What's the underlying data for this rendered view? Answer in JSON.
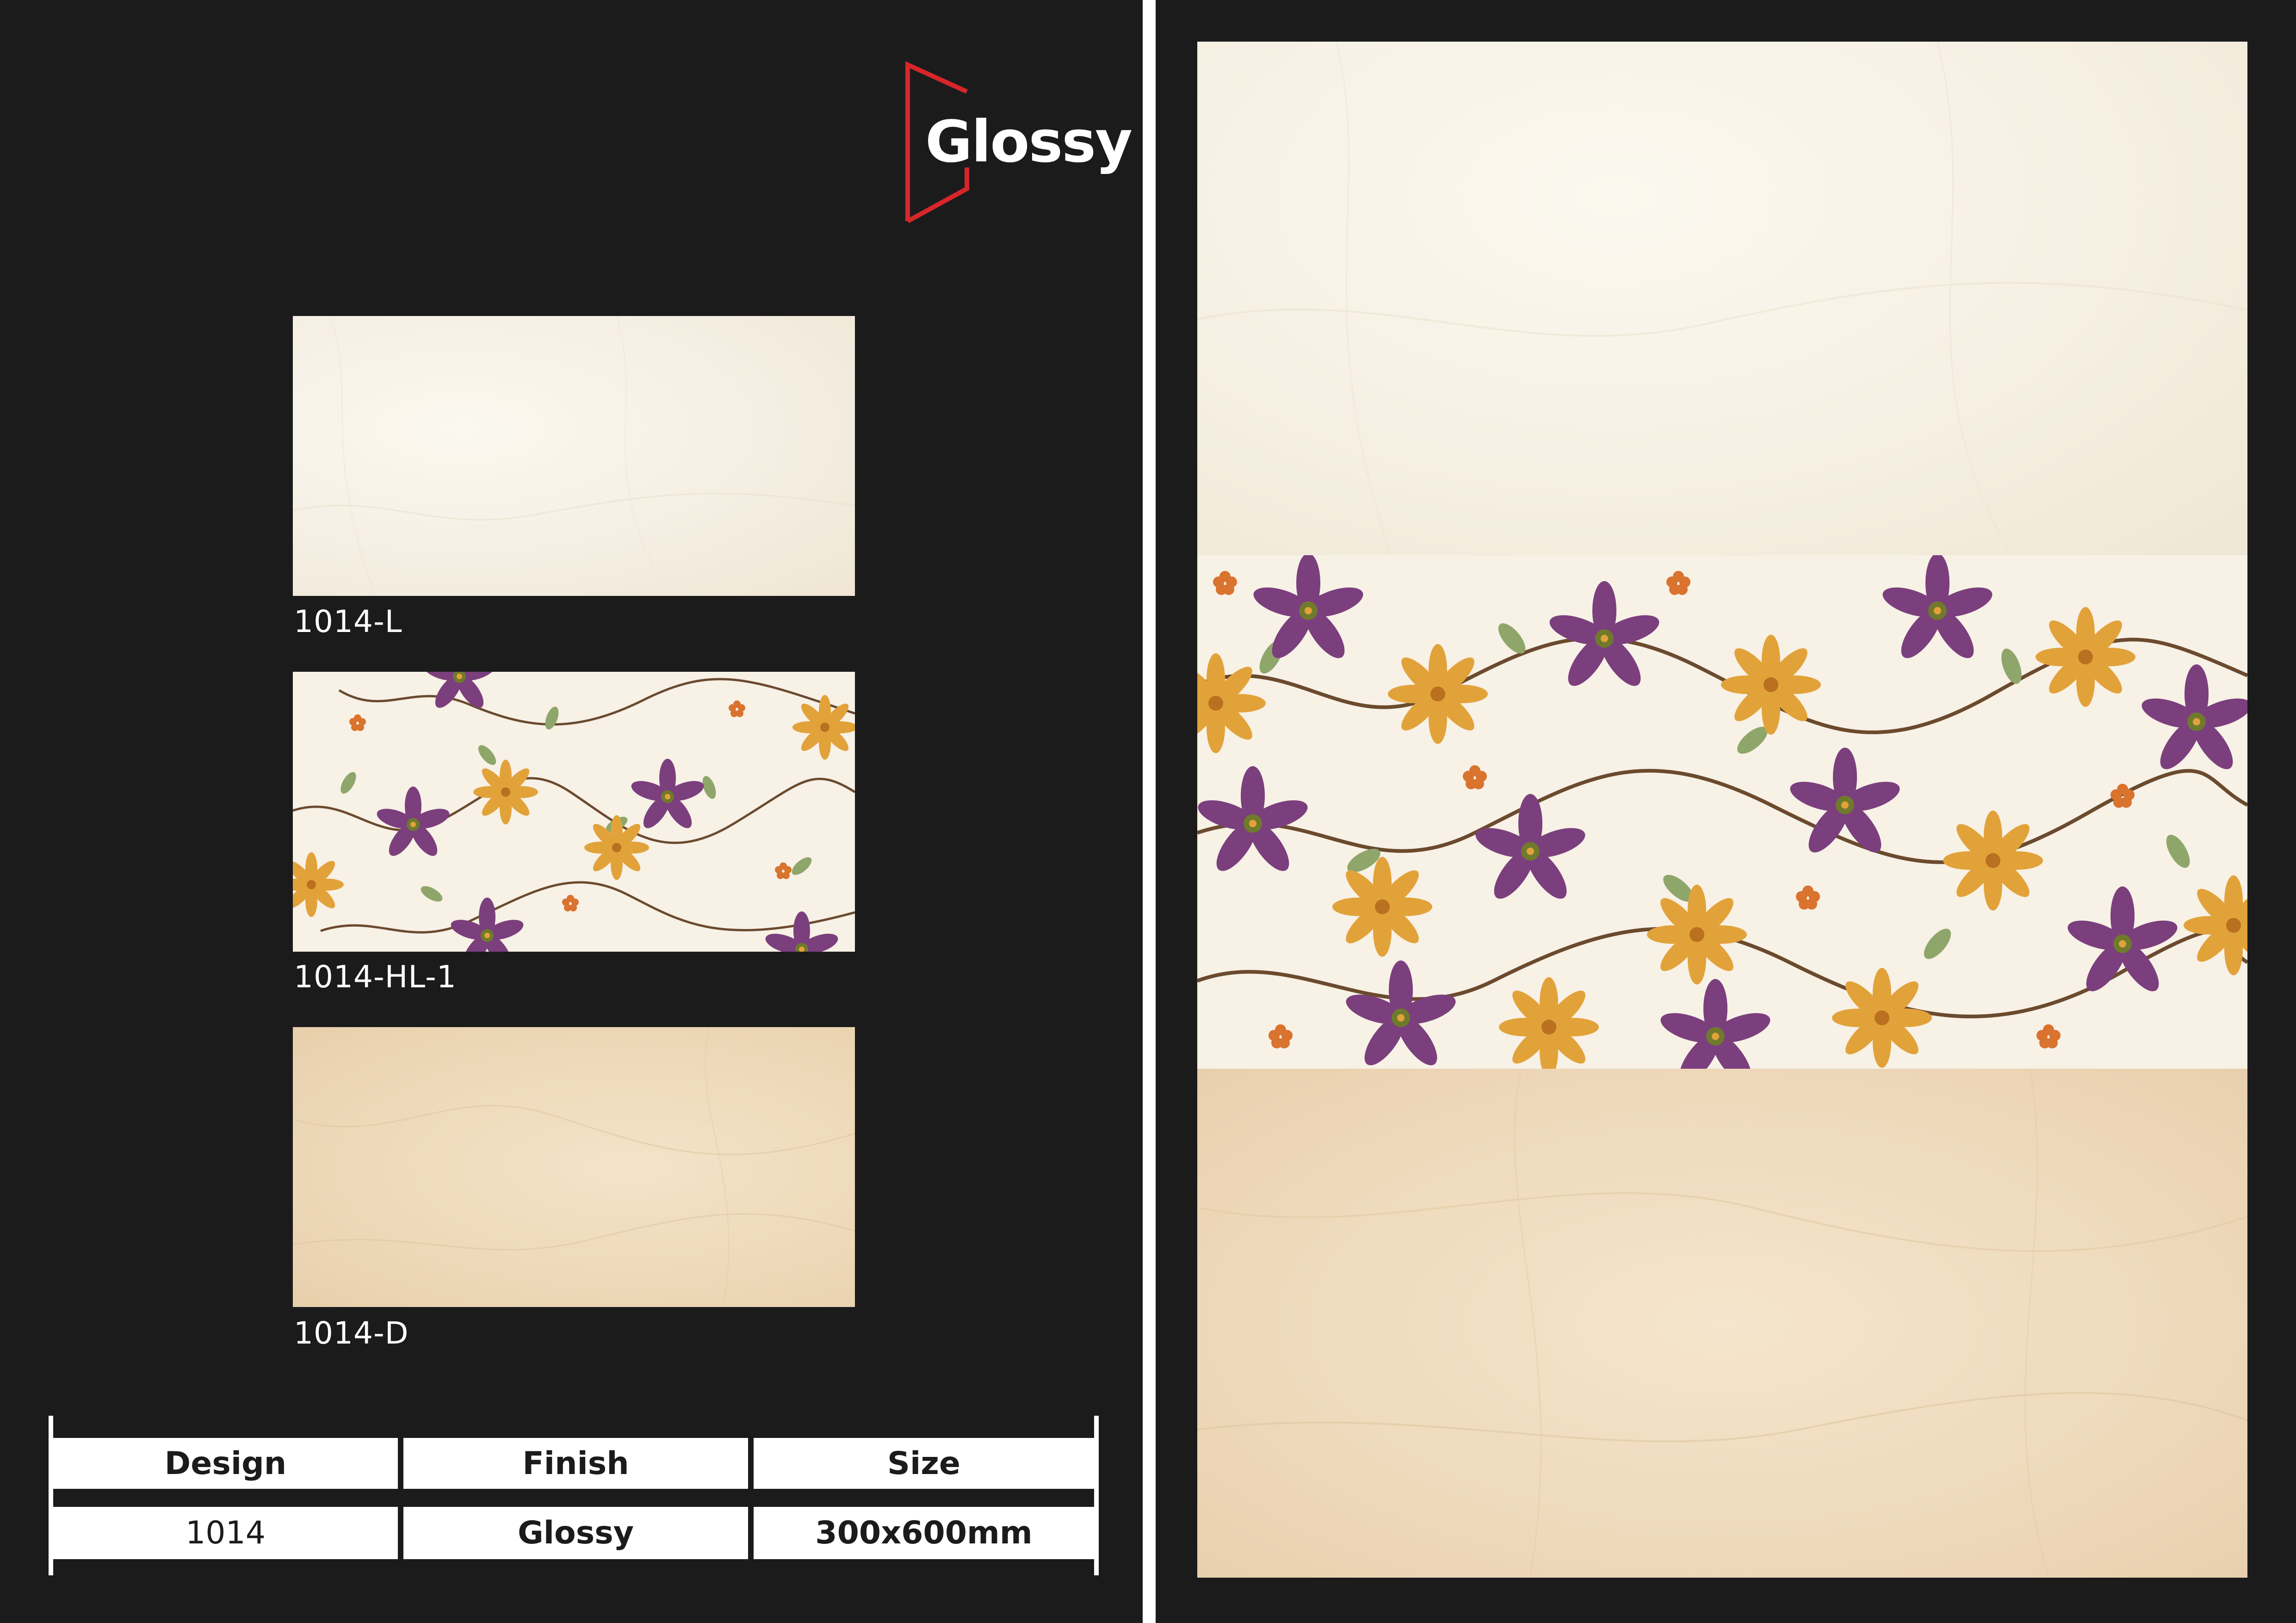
{
  "brand": {
    "name": "Glossy",
    "accent": "#d6262a"
  },
  "tiles": [
    {
      "code": "1014-L",
      "pattern": "light-marble",
      "color": "#f5efe3"
    },
    {
      "code": "1014-HL-1",
      "pattern": "floral-highlighter",
      "color": "#f7f1e6"
    },
    {
      "code": "1014-D",
      "pattern": "dark-marble",
      "color": "#eedab9"
    }
  ],
  "spec": {
    "headers": [
      "Design",
      "Finish",
      "Size"
    ],
    "values": [
      "1014",
      "Glossy",
      "300x600mm"
    ]
  },
  "colors": {
    "background": "#1b1b1c",
    "flower_purple": "#7b3f7d",
    "flower_orange": "#e2a23a",
    "leaf_green": "#8fa66b"
  }
}
